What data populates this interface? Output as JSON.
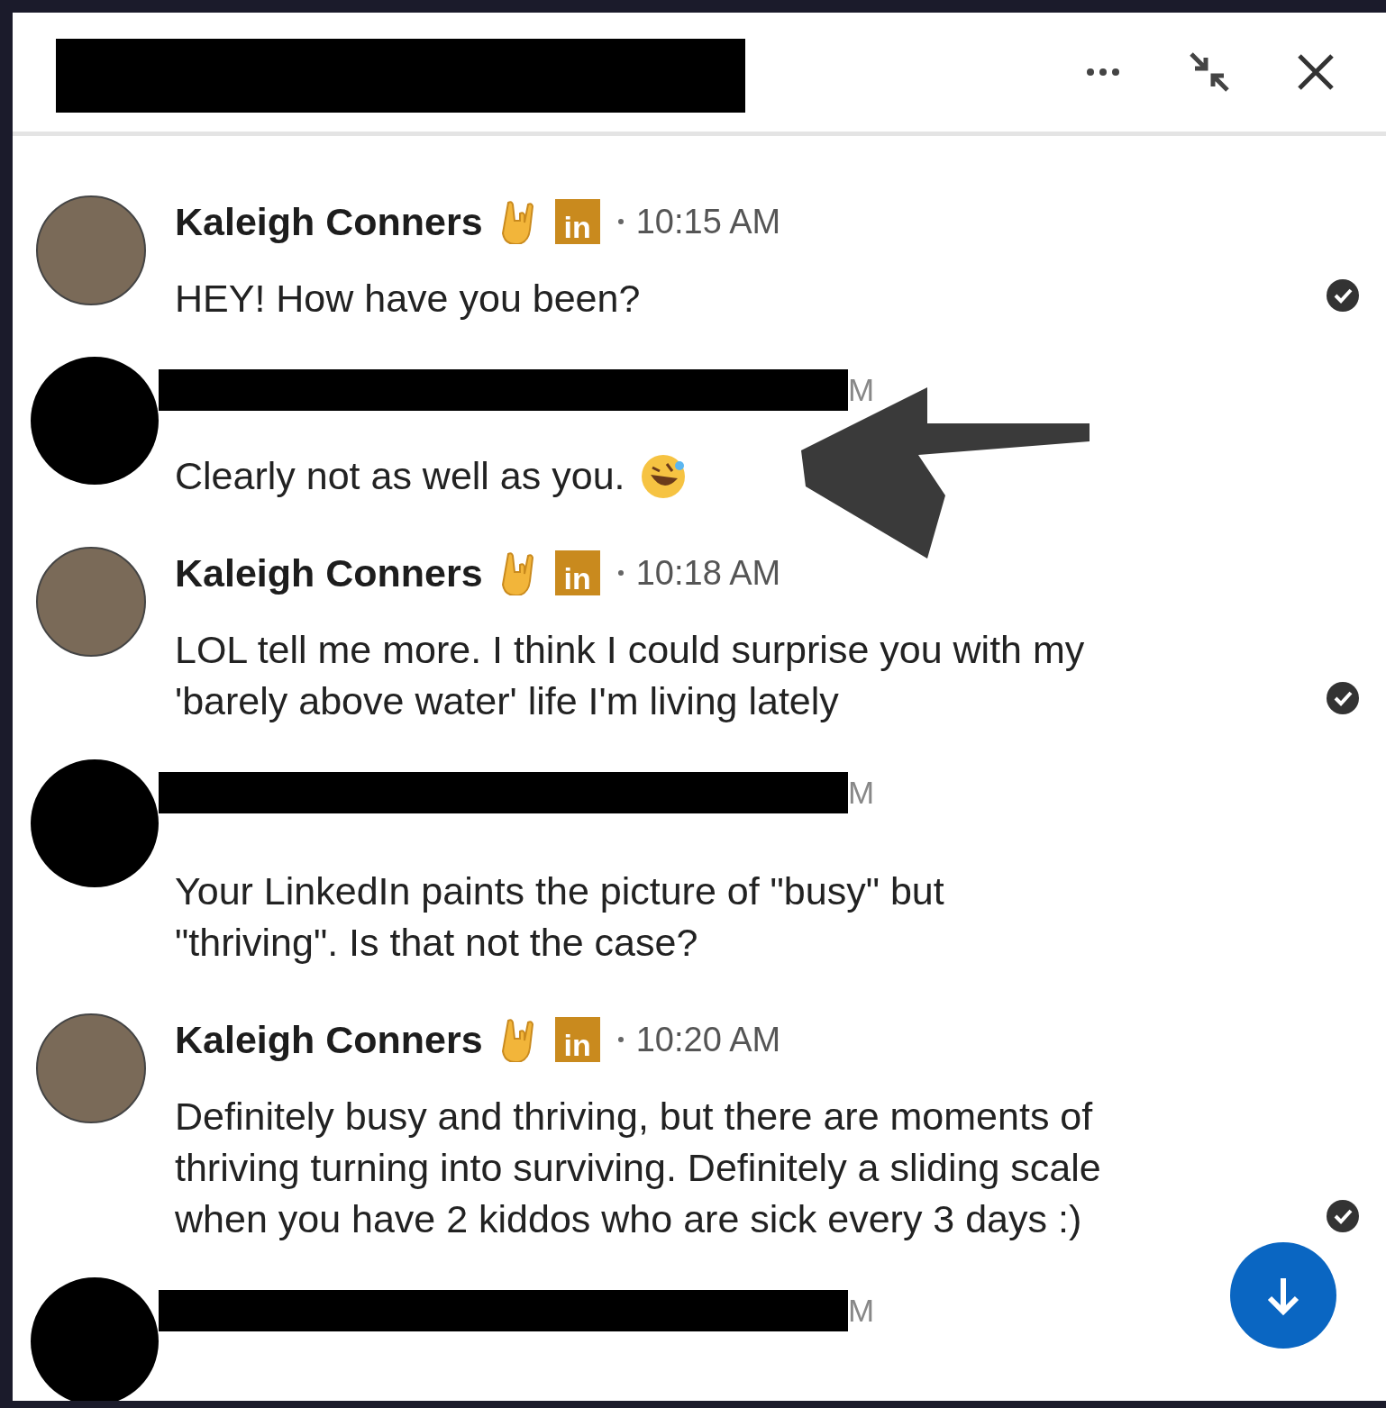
{
  "messages": [
    {
      "kind": "contact",
      "name": "Kaleigh Conners",
      "badge": "in",
      "time": "10:15 AM",
      "lines": [
        "HEY! How have you been?"
      ],
      "seen": true
    },
    {
      "kind": "redacted",
      "fragment": "M",
      "lines": [
        "Clearly not as well as you."
      ],
      "laughing_emoji": true,
      "annotated": true,
      "seen": false
    },
    {
      "kind": "contact",
      "name": "Kaleigh Conners",
      "badge": "in",
      "time": "10:18 AM",
      "lines": [
        "LOL tell me more. I think I could surprise you with my",
        "'barely above water' life I'm living lately"
      ],
      "seen": true
    },
    {
      "kind": "redacted",
      "fragment": "M",
      "lines": [
        "Your LinkedIn paints the picture of \"busy\" but",
        "\"thriving\". Is that not the case?"
      ],
      "seen": false
    },
    {
      "kind": "contact",
      "name": "Kaleigh Conners",
      "badge": "in",
      "time": "10:20 AM",
      "lines": [
        "Definitely busy and thriving, but there are moments of",
        "thriving turning into surviving. Definitely a sliding scale",
        "when you have 2 kiddos who are sick every 3 days :)"
      ],
      "seen": true
    },
    {
      "kind": "redacted",
      "fragment": "M",
      "seen": false
    }
  ]
}
